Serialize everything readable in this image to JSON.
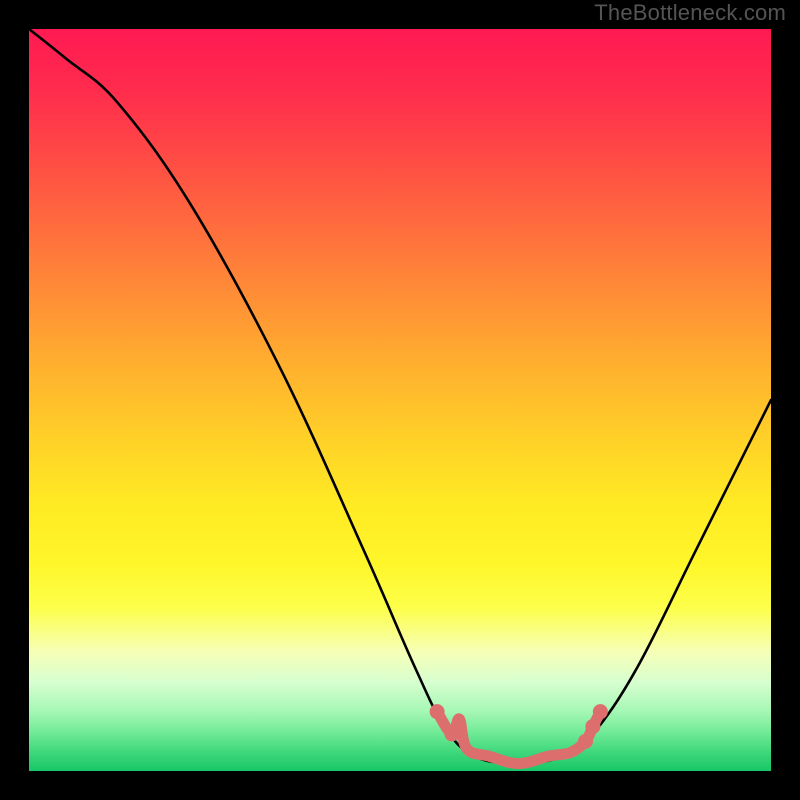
{
  "watermark": "TheBottleneck.com",
  "chart_data": {
    "type": "line",
    "title": "",
    "xlabel": "",
    "ylabel": "",
    "xlim": [
      0,
      100
    ],
    "ylim": [
      0,
      100
    ],
    "gradient_stops": [
      {
        "pos": 0,
        "color": "#ff1a52"
      },
      {
        "pos": 8,
        "color": "#ff2b4d"
      },
      {
        "pos": 16,
        "color": "#ff4646"
      },
      {
        "pos": 26,
        "color": "#ff6a3e"
      },
      {
        "pos": 36,
        "color": "#ff8e36"
      },
      {
        "pos": 46,
        "color": "#ffb22e"
      },
      {
        "pos": 56,
        "color": "#ffd327"
      },
      {
        "pos": 64,
        "color": "#ffea24"
      },
      {
        "pos": 72,
        "color": "#fff62a"
      },
      {
        "pos": 78,
        "color": "#fdff4a"
      },
      {
        "pos": 84,
        "color": "#f6ffb8"
      },
      {
        "pos": 88,
        "color": "#d7ffcf"
      },
      {
        "pos": 92,
        "color": "#a5f7b4"
      },
      {
        "pos": 95,
        "color": "#6de994"
      },
      {
        "pos": 97.5,
        "color": "#3ed77b"
      },
      {
        "pos": 100,
        "color": "#18c766"
      }
    ],
    "series": [
      {
        "name": "bottleneck-curve",
        "stroke": "#000000",
        "points": [
          {
            "x": 0,
            "y": 100
          },
          {
            "x": 5,
            "y": 96
          },
          {
            "x": 12,
            "y": 90
          },
          {
            "x": 22,
            "y": 76
          },
          {
            "x": 34,
            "y": 54
          },
          {
            "x": 45,
            "y": 30
          },
          {
            "x": 52,
            "y": 14
          },
          {
            "x": 56,
            "y": 6
          },
          {
            "x": 60,
            "y": 2
          },
          {
            "x": 66,
            "y": 1
          },
          {
            "x": 72,
            "y": 2
          },
          {
            "x": 76,
            "y": 5
          },
          {
            "x": 82,
            "y": 14
          },
          {
            "x": 90,
            "y": 30
          },
          {
            "x": 100,
            "y": 50
          }
        ]
      },
      {
        "name": "optimal-band",
        "stroke": "#dd6e6e",
        "points": [
          {
            "x": 55,
            "y": 8
          },
          {
            "x": 57,
            "y": 5
          },
          {
            "x": 58,
            "y": 7
          },
          {
            "x": 59,
            "y": 3
          },
          {
            "x": 62,
            "y": 2
          },
          {
            "x": 66,
            "y": 1
          },
          {
            "x": 70,
            "y": 2
          },
          {
            "x": 73,
            "y": 2.5
          },
          {
            "x": 75,
            "y": 4
          },
          {
            "x": 76,
            "y": 6
          },
          {
            "x": 77,
            "y": 8
          }
        ],
        "markers": [
          {
            "x": 55,
            "y": 8
          },
          {
            "x": 57,
            "y": 5
          },
          {
            "x": 75,
            "y": 4
          },
          {
            "x": 76,
            "y": 6
          },
          {
            "x": 77,
            "y": 8
          }
        ]
      }
    ]
  }
}
